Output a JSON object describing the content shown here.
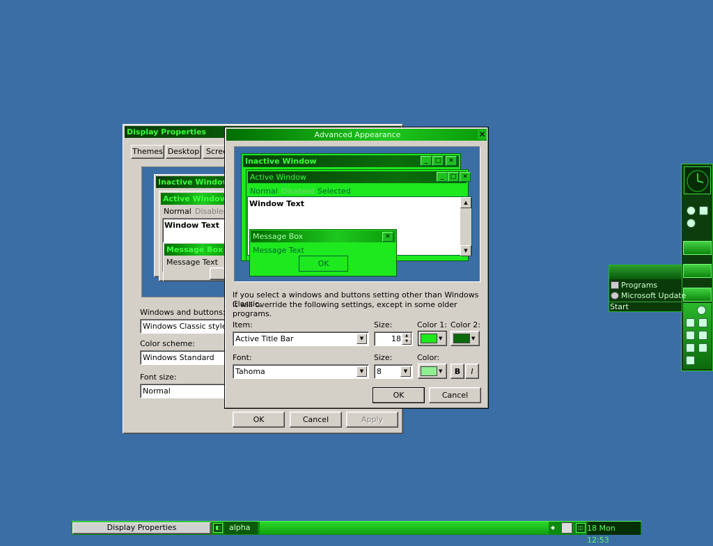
{
  "display_props": {
    "title": "Display Properties",
    "tabs": [
      "Themes",
      "Desktop",
      "Scree"
    ],
    "preview": {
      "inactive_title": "Inactive Window",
      "active_title": "Active Window",
      "menu_normal": "Normal",
      "menu_disabled": "Disabled",
      "window_text": "Window Text",
      "msg_title": "Message Box",
      "msg_text": "Message Text"
    },
    "windows_buttons_label": "Windows and buttons:",
    "windows_buttons_value": "Windows Classic style",
    "color_scheme_label": "Color scheme:",
    "color_scheme_value": "Windows Standard",
    "font_size_label": "Font size:",
    "font_size_value": "Normal",
    "ok": "OK",
    "cancel": "Cancel",
    "apply": "Apply"
  },
  "advanced": {
    "title": "Advanced Appearance",
    "close_glyph": "✕",
    "preview": {
      "inactive_title": "Inactive Window",
      "active_title": "Active Window",
      "menu_normal": "Normal",
      "menu_disabled": "Disabled",
      "menu_selected": "Selected",
      "window_text": "Window Text",
      "msg_title": "Message Box",
      "msg_text": "Message Text",
      "msg_ok": "OK"
    },
    "info_line1": "If you select a windows and buttons setting other than Windows Classic,",
    "info_line2": "it will override the following settings, except in some older programs.",
    "item_label": "Item:",
    "item_value": "Active Title Bar",
    "size_label": "Size:",
    "size_value": "18",
    "color1_label": "Color 1:",
    "color2_label": "Color 2:",
    "color1": "#1ee81e",
    "color2": "#0a6b0a",
    "font_label": "Font:",
    "font_value": "Tahoma",
    "font_size_label": "Size:",
    "font_size_value": "8",
    "font_color_label": "Color:",
    "font_color": "#90ee90",
    "bold": "B",
    "italic": "I",
    "ok": "OK",
    "cancel": "Cancel"
  },
  "start_menu": {
    "items": [
      "Programs",
      "Microsoft Update"
    ],
    "start": "Start"
  },
  "taskbar": {
    "task": "Display Properties",
    "workspace": "alpha",
    "clock": "18 Mon 12:53"
  }
}
